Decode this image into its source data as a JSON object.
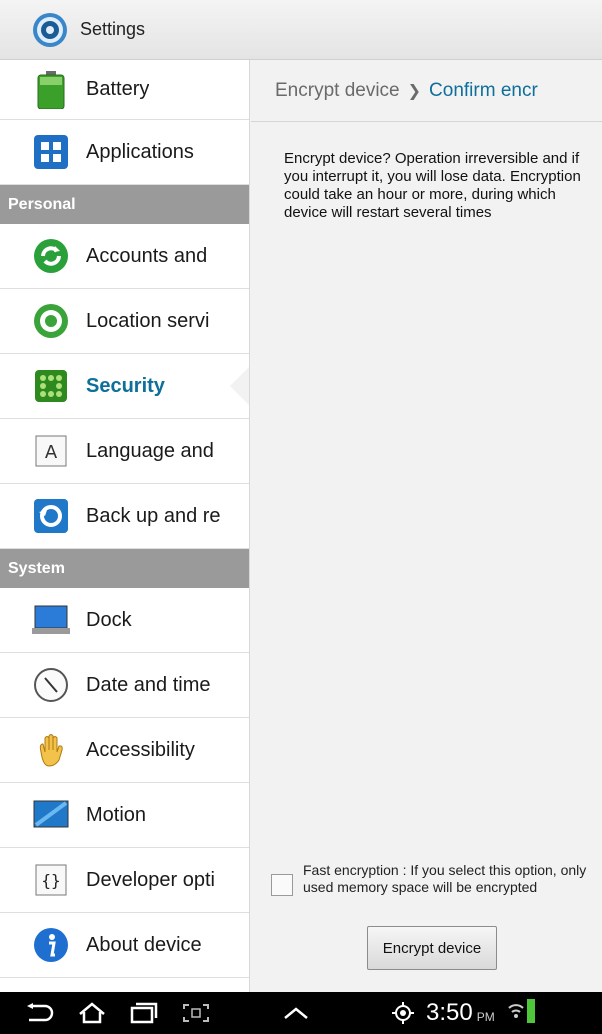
{
  "app": {
    "title": "Settings",
    "icon": "settings-gear-icon"
  },
  "sidebar": {
    "items": [
      {
        "id": "battery",
        "label": "Battery",
        "icon": "battery-icon"
      },
      {
        "id": "applications",
        "label": "Applications",
        "icon": "applications-icon"
      },
      {
        "id": "personal",
        "section": true,
        "label": "Personal"
      },
      {
        "id": "accounts",
        "label": "Accounts and",
        "icon": "accounts-sync-icon"
      },
      {
        "id": "location",
        "label": "Location servi",
        "icon": "location-icon"
      },
      {
        "id": "security",
        "label": "Security",
        "icon": "security-icon",
        "selected": true
      },
      {
        "id": "language",
        "label": "Language and",
        "icon": "language-icon"
      },
      {
        "id": "backup",
        "label": "Back up and re",
        "icon": "backup-icon"
      },
      {
        "id": "system",
        "section": true,
        "label": "System"
      },
      {
        "id": "dock",
        "label": "Dock",
        "icon": "dock-icon"
      },
      {
        "id": "datetime",
        "label": "Date and time",
        "icon": "clock-icon"
      },
      {
        "id": "accessibility",
        "label": "Accessibility",
        "icon": "hand-icon"
      },
      {
        "id": "motion",
        "label": "Motion",
        "icon": "motion-icon"
      },
      {
        "id": "developer",
        "label": "Developer opti",
        "icon": "developer-braces-icon"
      },
      {
        "id": "about",
        "label": "About device",
        "icon": "info-icon"
      }
    ]
  },
  "detail": {
    "breadcrumb": {
      "parent": "Encrypt device",
      "current": "Confirm encr"
    },
    "description": "Encrypt device? Operation irreversible and if you interrupt it, you will lose data. Encryption could take an hour or more, during which device will restart several times",
    "fast_encryption": {
      "label": "Fast encryption : If you select this option, only used memory space will be encrypted",
      "checked": false
    },
    "encrypt_button": "Encrypt device"
  },
  "statusbar": {
    "time": "3:50",
    "ampm": "PM"
  },
  "colors": {
    "accent": "#0d6f9a",
    "section": "#9a9a9a",
    "navbar": "#000000"
  }
}
